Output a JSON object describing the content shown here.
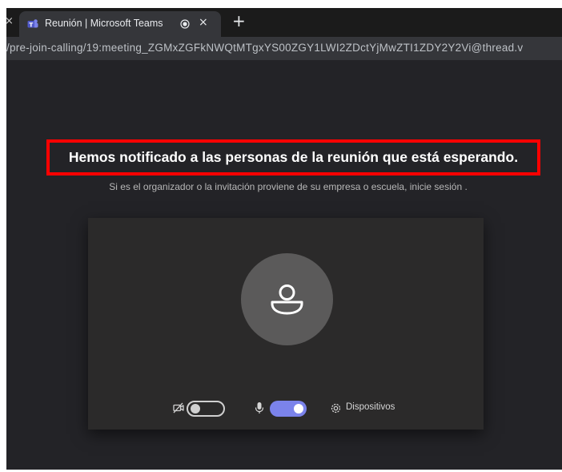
{
  "browser": {
    "prev_tab_close": "×",
    "tab": {
      "title": "Reunión | Microsoft Teams",
      "close": "×",
      "favicon": "teams-icon",
      "indicator": "recording-indicator-icon"
    },
    "new_tab": "+",
    "url": "/pre-join-calling/19:meeting_ZGMxZGFkNWQtMTgxYS00ZGY1LWI2ZDctYjMwZTI1ZDY2Y2Vi@thread.v"
  },
  "prejoin": {
    "headline": "Hemos notificado a las personas de la reunión que está esperando.",
    "subtext": "Si es el organizador o la invitación proviene de su empresa o escuela, inicie sesión .",
    "avatar_icon": "person-icon",
    "camera": {
      "icon": "camera-off-icon",
      "enabled": false
    },
    "microphone": {
      "icon": "microphone-icon",
      "enabled": true
    },
    "devices": {
      "icon": "gear-icon",
      "label": "Dispositivos"
    }
  },
  "colors": {
    "accent": "#7b83eb",
    "highlight_border": "#ff0000",
    "background": "#232327"
  }
}
